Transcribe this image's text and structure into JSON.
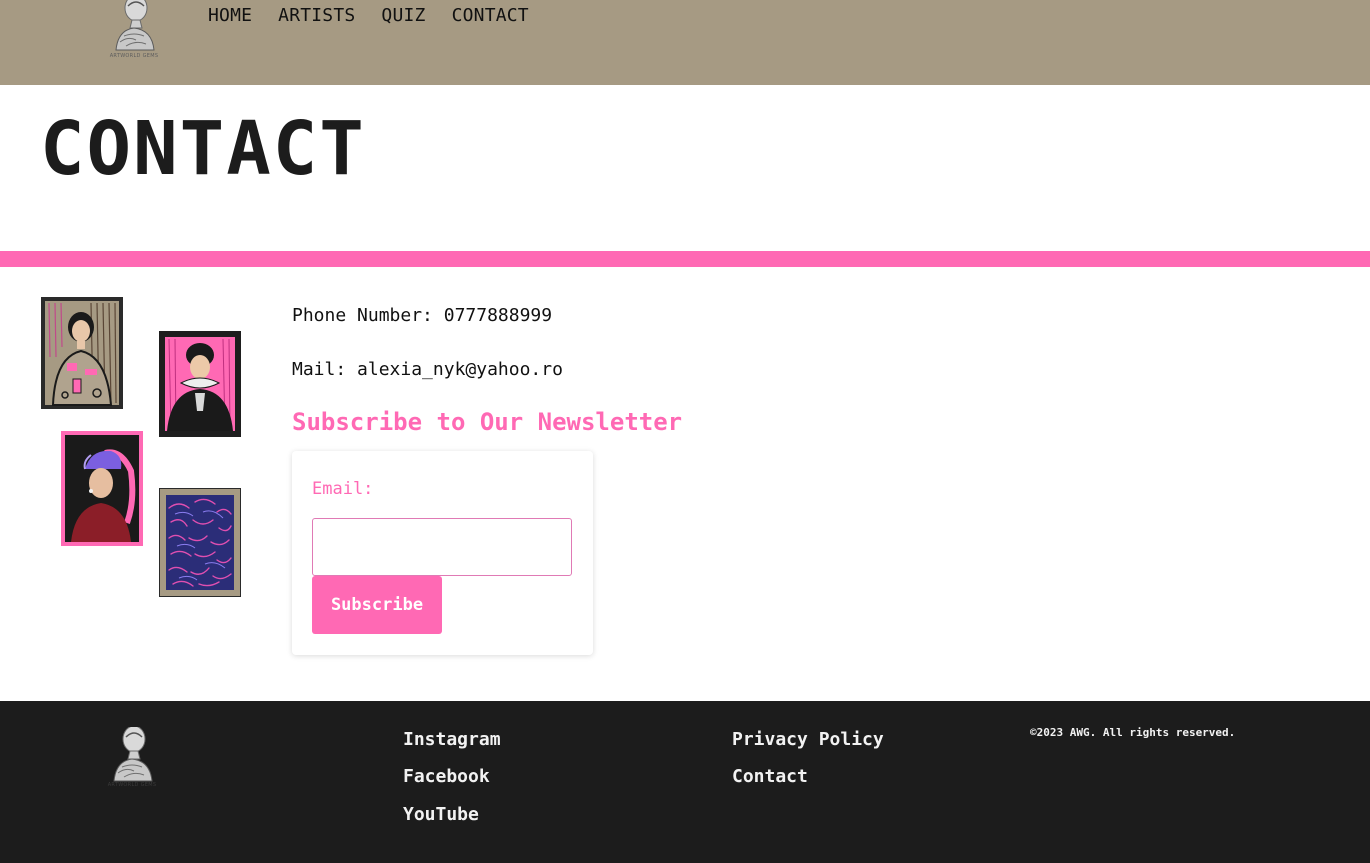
{
  "brand": {
    "logo_text": "ARTWORLD GEMS"
  },
  "nav": {
    "items": [
      "HOME",
      "ARTISTS",
      "QUIZ",
      "CONTACT"
    ]
  },
  "page": {
    "title": "CONTACT"
  },
  "contact": {
    "phone_label": "Phone Number:",
    "phone_value": "0777888999",
    "mail_label": "Mail:",
    "mail_value": "alexia_nyk@yahoo.ro"
  },
  "newsletter": {
    "title": "Subscribe to Our Newsletter",
    "email_label": "Email:",
    "email_value": "",
    "button_label": "Subscribe"
  },
  "footer": {
    "social": [
      "Instagram",
      "Facebook",
      "YouTube"
    ],
    "links": [
      "Privacy Policy",
      "Contact"
    ],
    "copyright": "©2023 AWG. All rights reserved."
  },
  "colors": {
    "nav_bg": "#a69a83",
    "accent_pink": "#ff69b4",
    "footer_bg": "#1c1c1c"
  }
}
